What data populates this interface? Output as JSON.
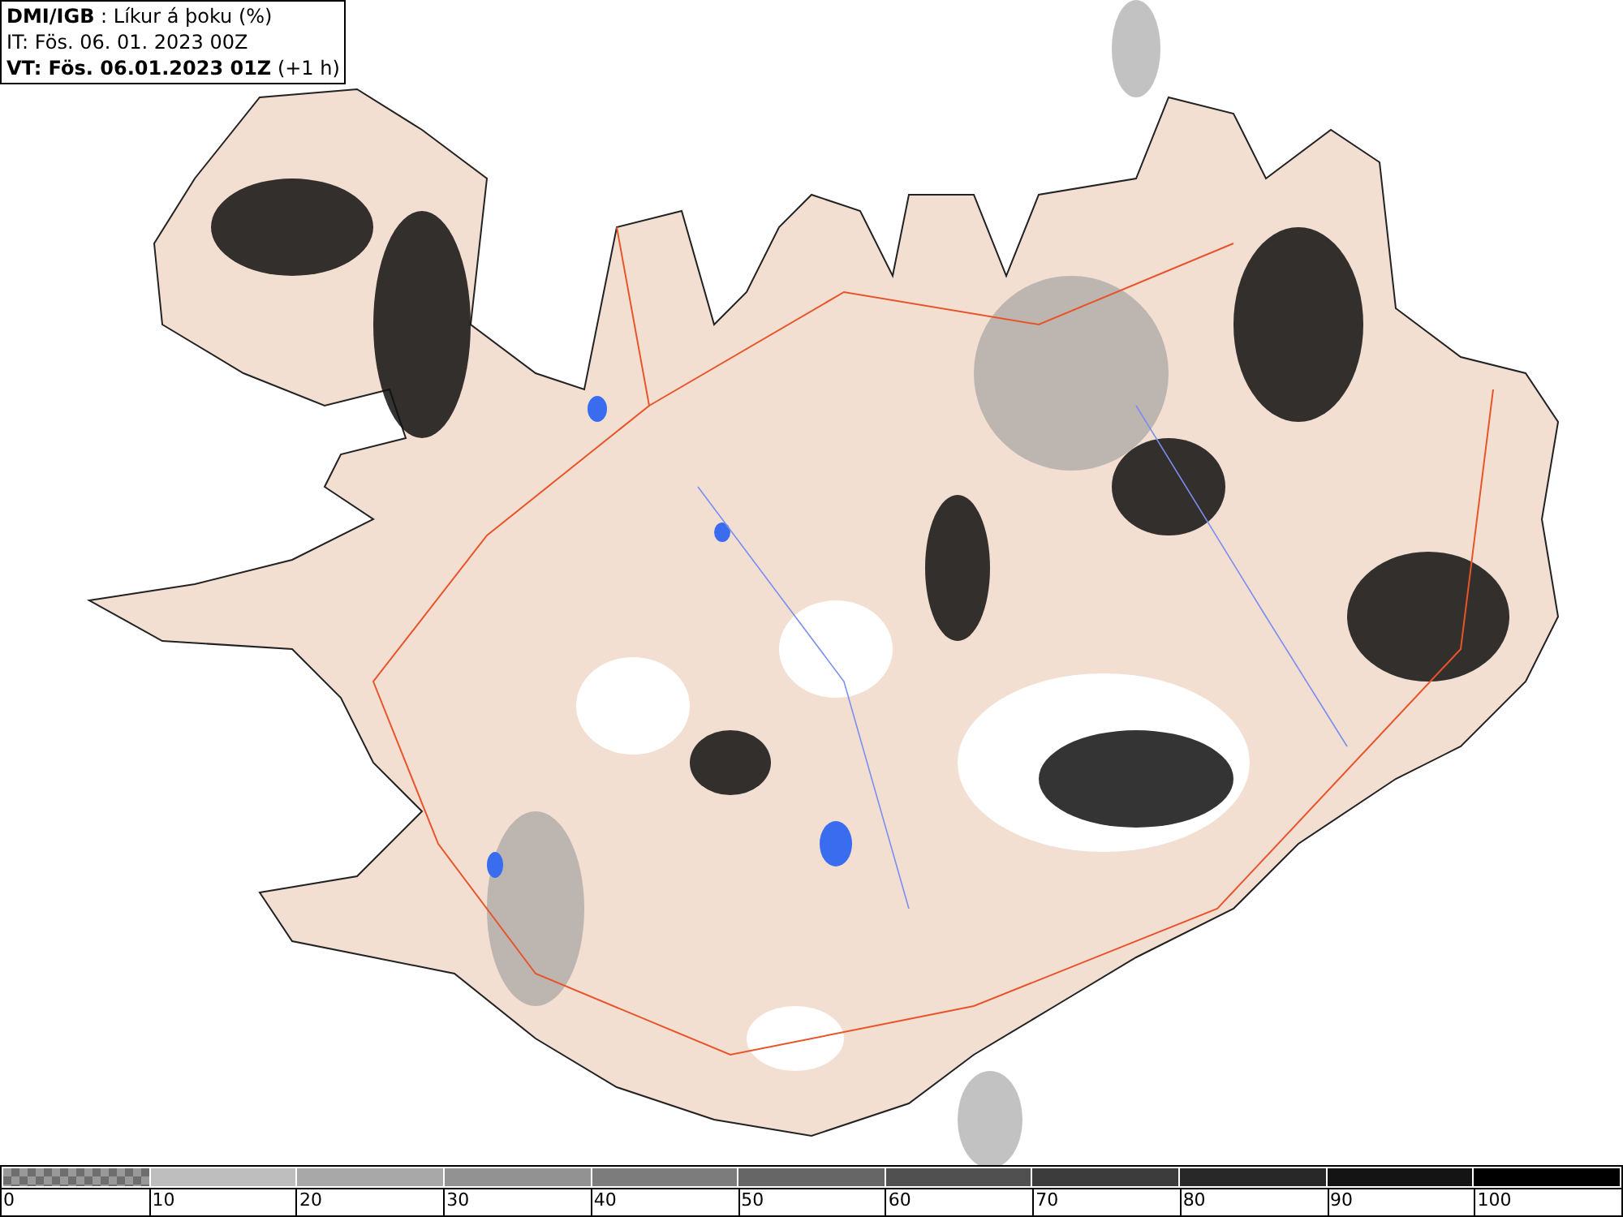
{
  "header": {
    "lines": [
      "**DMI/IGB** : Líkur á þoku (%)",
      "IT: Fös. 06. 01. 2023 00Z",
      "**VT: Fös. 06.01.2023 01Z** (+1 h)"
    ]
  },
  "legend": {
    "bins": [
      {
        "kind": "checker",
        "color": "#6e6e6e"
      },
      {
        "kind": "solid",
        "color": "#bebebe"
      },
      {
        "kind": "solid",
        "color": "#a8a8a8"
      },
      {
        "kind": "solid",
        "color": "#929292"
      },
      {
        "kind": "solid",
        "color": "#7c7c7c"
      },
      {
        "kind": "solid",
        "color": "#666666"
      },
      {
        "kind": "solid",
        "color": "#505050"
      },
      {
        "kind": "solid",
        "color": "#3c3c3c"
      },
      {
        "kind": "solid",
        "color": "#282828"
      },
      {
        "kind": "solid",
        "color": "#141414"
      },
      {
        "kind": "solid",
        "color": "#000000"
      }
    ],
    "labels": [
      "0",
      "10",
      "20",
      "30",
      "40",
      "50",
      "60",
      "70",
      "80",
      "90",
      "100"
    ]
  }
}
